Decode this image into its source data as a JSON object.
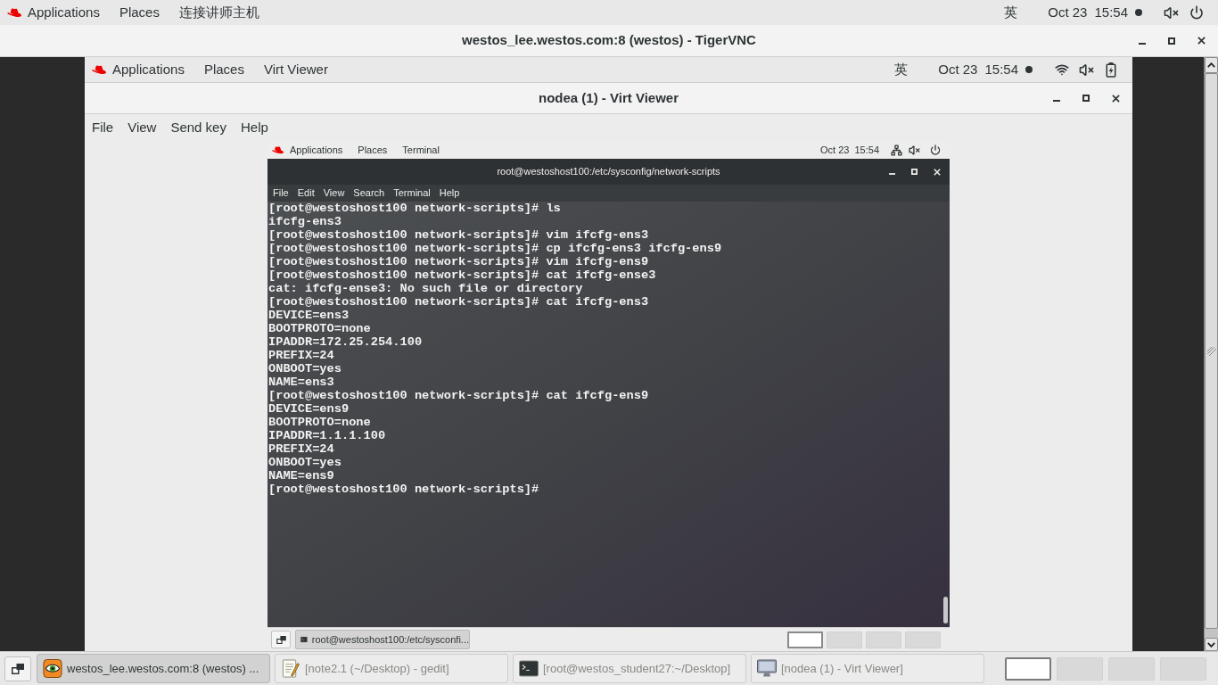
{
  "top_bar": {
    "menus": [
      "Applications",
      "Places",
      "连接讲师主机"
    ],
    "input_method": "英",
    "date": "Oct 23",
    "time": "15:54"
  },
  "vnc_window": {
    "title": "westos_lee.westos.com:8 (westos) - TigerVNC"
  },
  "remote_top_bar": {
    "menus": [
      "Applications",
      "Places",
      "Virt Viewer"
    ],
    "input_method": "英",
    "date": "Oct 23",
    "time": "15:54"
  },
  "viewer_window": {
    "title": "nodea (1) - Virt Viewer",
    "menu": [
      "File",
      "View",
      "Send key",
      "Help"
    ]
  },
  "guest": {
    "top_bar": {
      "menus": [
        "Applications",
        "Places",
        "Terminal"
      ],
      "date": "Oct 23",
      "time": "15:54"
    },
    "terminal": {
      "title": "root@westoshost100:/etc/sysconfig/network-scripts",
      "menu": [
        "File",
        "Edit",
        "View",
        "Search",
        "Terminal",
        "Help"
      ],
      "lines": [
        "[root@westoshost100 network-scripts]# ls",
        "ifcfg-ens3",
        "[root@westoshost100 network-scripts]# vim ifcfg-ens3",
        "[root@westoshost100 network-scripts]# cp ifcfg-ens3 ifcfg-ens9",
        "[root@westoshost100 network-scripts]# vim ifcfg-ens9",
        "[root@westoshost100 network-scripts]# cat ifcfg-ense3",
        "cat: ifcfg-ense3: No such file or directory",
        "[root@westoshost100 network-scripts]# cat ifcfg-ens3",
        "DEVICE=ens3",
        "BOOTPROTO=none",
        "IPADDR=172.25.254.100",
        "PREFIX=24",
        "ONBOOT=yes",
        "NAME=ens3",
        "[root@westoshost100 network-scripts]# cat ifcfg-ens9",
        "DEVICE=ens9",
        "BOOTPROTO=none",
        "IPADDR=1.1.1.100",
        "PREFIX=24",
        "ONBOOT=yes",
        "NAME=ens9",
        "[root@westoshost100 network-scripts]#"
      ]
    },
    "taskbar": {
      "tasks": [
        {
          "label": "root@westoshost100:/etc/sysconfi...",
          "kind": "terminal",
          "selected": true
        }
      ],
      "workspaces": [
        {
          "selected": true
        },
        {
          "selected": false
        },
        {
          "selected": false
        },
        {
          "selected": false
        }
      ]
    }
  },
  "taskbar": {
    "tasks": [
      {
        "label": "westos_lee.westos.com:8 (westos) ...",
        "kind": "vnc",
        "selected": true
      },
      {
        "label": "[note2.1 (~/Desktop) - gedit]",
        "kind": "editor",
        "selected": false
      },
      {
        "label": "[root@westos_student27:~/Desktop]",
        "kind": "terminal",
        "selected": false
      },
      {
        "label": "[nodea (1) - Virt Viewer]",
        "kind": "viewer",
        "selected": false
      }
    ],
    "workspaces": [
      {
        "selected": true
      },
      {
        "selected": false
      },
      {
        "selected": false
      },
      {
        "selected": false
      }
    ]
  }
}
